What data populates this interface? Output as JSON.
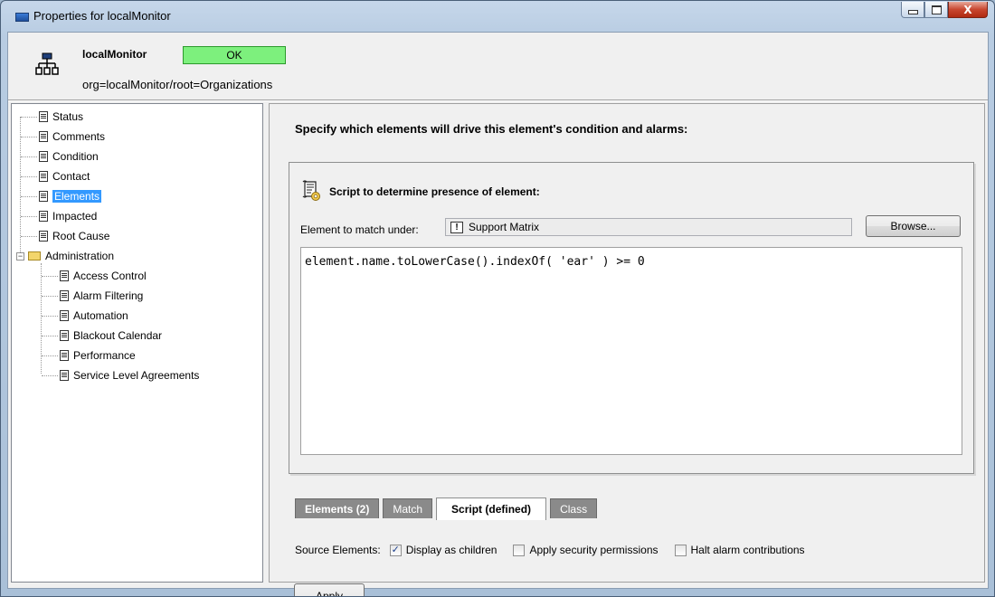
{
  "window": {
    "title": "Properties for localMonitor",
    "minimize_label": "",
    "maximize_label": "",
    "close_label": "X"
  },
  "header": {
    "element_name": "localMonitor",
    "status": "OK",
    "status_color": "#7df07d",
    "path": "org=localMonitor/root=Organizations"
  },
  "tree": {
    "items": [
      {
        "label": "Status",
        "icon": "document-icon"
      },
      {
        "label": "Comments",
        "icon": "document-icon"
      },
      {
        "label": "Condition",
        "icon": "document-icon"
      },
      {
        "label": "Contact",
        "icon": "document-icon"
      },
      {
        "label": "Elements",
        "icon": "document-icon",
        "selected": true
      },
      {
        "label": "Impacted",
        "icon": "document-icon"
      },
      {
        "label": "Root Cause",
        "icon": "document-icon"
      },
      {
        "label": "Administration",
        "icon": "folder-icon",
        "expanded": true,
        "children": [
          {
            "label": "Access Control"
          },
          {
            "label": "Alarm Filtering"
          },
          {
            "label": "Automation"
          },
          {
            "label": "Blackout Calendar"
          },
          {
            "label": "Performance"
          },
          {
            "label": "Service Level Agreements"
          }
        ]
      }
    ],
    "expander_symbol": "−"
  },
  "main": {
    "heading": "Specify which elements will drive this element's condition and alarms:",
    "script_panel": {
      "title": "Script to determine presence of element:",
      "match_label": "Element to match under:",
      "match_value": "Support Matrix",
      "match_icon_glyph": "!",
      "browse_label": "Browse...",
      "script": "element.name.toLowerCase().indexOf( 'ear' ) >= 0"
    },
    "tabs": [
      {
        "label": "Elements (2)",
        "active": false
      },
      {
        "label": "Match",
        "active": false
      },
      {
        "label": "Script (defined)",
        "active": true
      },
      {
        "label": "Class",
        "active": false
      }
    ],
    "source_label": "Source Elements:",
    "options": [
      {
        "label": "Display as children",
        "checked": true
      },
      {
        "label": "Apply security permissions",
        "checked": false
      },
      {
        "label": "Halt alarm contributions",
        "checked": false
      }
    ],
    "check_glyph": "✓",
    "apply_label": "Apply"
  }
}
